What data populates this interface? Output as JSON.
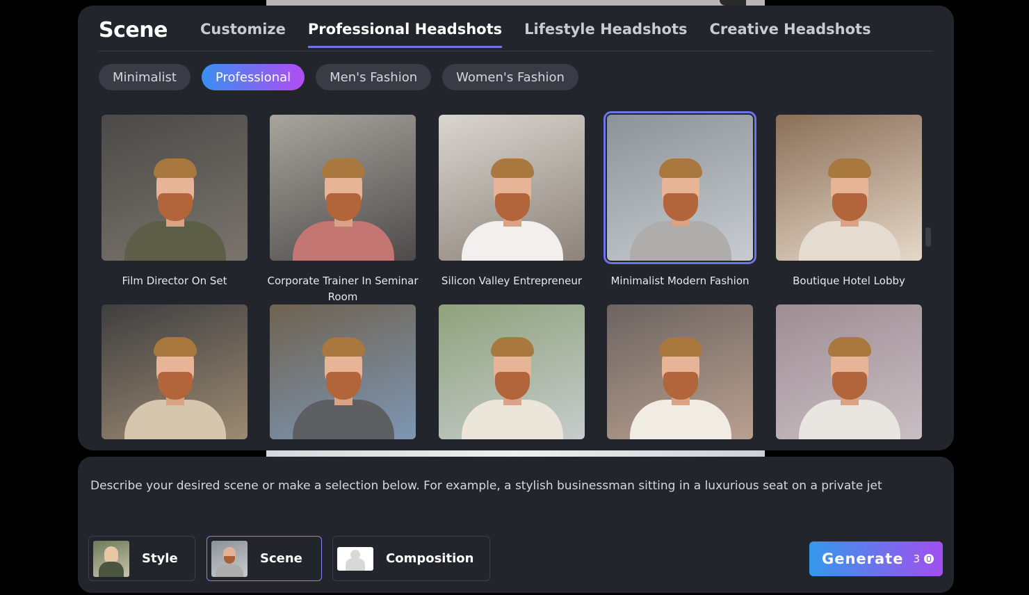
{
  "panel": {
    "title": "Scene",
    "tabs": [
      {
        "label": "Customize",
        "active": false
      },
      {
        "label": "Professional Headshots",
        "active": true
      },
      {
        "label": "Lifestyle Headshots",
        "active": false
      },
      {
        "label": "Creative Headshots",
        "active": false
      }
    ],
    "chips": [
      {
        "label": "Minimalist",
        "active": false
      },
      {
        "label": "Professional",
        "active": true
      },
      {
        "label": "Men's Fashion",
        "active": false
      },
      {
        "label": "Women's Fashion",
        "active": false
      }
    ],
    "scenes": [
      {
        "label": "Film Director On Set",
        "selected": false,
        "bg": "#4b4a48",
        "bg2": "#7a746c",
        "outfit": "#5d5e48"
      },
      {
        "label": "Corporate Trainer In Seminar Room",
        "selected": false,
        "bg": "#a8a49e",
        "bg2": "#4d4b49",
        "outfit": "#c47772"
      },
      {
        "label": "Silicon Valley Entrepreneur",
        "selected": false,
        "bg": "#d9d5cf",
        "bg2": "#8c8379",
        "outfit": "#f1f0ee"
      },
      {
        "label": "Minimalist Modern Fashion",
        "selected": true,
        "bg": "#8c9398",
        "bg2": "#c8ccd0",
        "outfit": "#aeadab"
      },
      {
        "label": "Boutique Hotel Lobby",
        "selected": false,
        "bg": "#8a6f58",
        "bg2": "#e6d8c8",
        "outfit": "#e4dcd0"
      },
      {
        "label": "",
        "selected": false,
        "bg": "#3f3f40",
        "bg2": "#9c8a72",
        "outfit": "#d6c6ae"
      },
      {
        "label": "",
        "selected": false,
        "bg": "#6f6250",
        "bg2": "#7d97b4",
        "outfit": "#5d5f63"
      },
      {
        "label": "",
        "selected": false,
        "bg": "#8fa27c",
        "bg2": "#c6cccc",
        "outfit": "#ece6da"
      },
      {
        "label": "",
        "selected": false,
        "bg": "#6c6460",
        "bg2": "#b9a090",
        "outfit": "#f0ebe3"
      },
      {
        "label": "",
        "selected": false,
        "bg": "#9e8e94",
        "bg2": "#c9bec3",
        "outfit": "#e9e6e2"
      }
    ]
  },
  "prompt": {
    "placeholder": "Describe your desired scene or make a selection below. For example, a stylish businessman sitting in a luxurious seat on a private jet"
  },
  "options": [
    {
      "label": "Style",
      "icon": "style-thumbnail",
      "active": false
    },
    {
      "label": "Scene",
      "icon": "scene-thumbnail",
      "active": true
    },
    {
      "label": "Composition",
      "icon": "person-silhouette-icon",
      "active": false
    }
  ],
  "generate": {
    "label": "Generate",
    "count": "3",
    "icon": "coin-icon"
  },
  "colors": {
    "accent_start": "#3a8ff0",
    "accent_end": "#b24cf2",
    "panel_bg": "#22252c",
    "selected_outline": "#6b74e8"
  }
}
